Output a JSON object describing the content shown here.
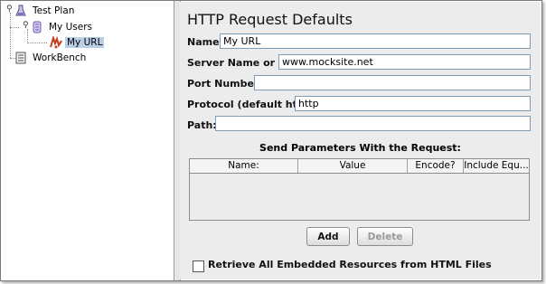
{
  "tree": {
    "items": [
      {
        "label": "Test Plan"
      },
      {
        "label": "My Users"
      },
      {
        "label": "My URL"
      },
      {
        "label": "WorkBench"
      }
    ],
    "icons": [
      "test-plan-icon",
      "thread-group-icon",
      "http-sampler-icon",
      "workbench-icon"
    ]
  },
  "panel": {
    "title": "HTTP Request Defaults",
    "fields": {
      "name": {
        "label": "Name:",
        "value": "My URL"
      },
      "server": {
        "label": "Server Name or IP:",
        "value": "www.mocksite.net"
      },
      "port": {
        "label": "Port Number:",
        "value": ""
      },
      "protocol": {
        "label": "Protocol (default http):",
        "value": "http"
      },
      "path": {
        "label": "Path:",
        "value": ""
      }
    },
    "params_title": "Send Parameters With the Request:",
    "columns": [
      "Name:",
      "Value",
      "Encode?",
      "Include Equ..."
    ],
    "add_label": "Add",
    "delete_label": "Delete",
    "retrieve_label": "Retrieve All Embedded Resources from HTML Files",
    "retrieve_checked": false
  }
}
